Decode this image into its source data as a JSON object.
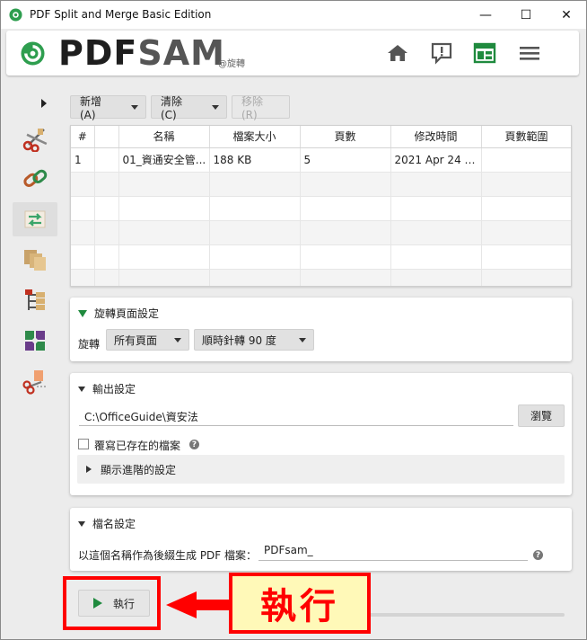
{
  "window": {
    "title": "PDF Split and Merge Basic Edition",
    "minimize": "—",
    "maximize": "☐",
    "close": "✕"
  },
  "header": {
    "logo_pdf": "PDF",
    "logo_sam": "SAM",
    "module_tag": "@旋轉"
  },
  "toolbar": {
    "add_label": "新增 (A)",
    "clear_label": "清除 (C)",
    "remove_label": "移除 (R)"
  },
  "table": {
    "columns": [
      "#",
      "",
      "名稱",
      "檔案大小",
      "頁數",
      "修改時間",
      "頁數範圍"
    ],
    "rows": [
      [
        "1",
        "",
        "01_資通安全管...",
        "188 KB",
        "5",
        "2021 Apr 24 1...",
        ""
      ]
    ]
  },
  "rotate_panel": {
    "title": "旋轉頁面設定",
    "rotate_label": "旋轉",
    "pages_value": "所有頁面",
    "angle_value": "順時針轉 90 度"
  },
  "output_panel": {
    "title": "輸出設定",
    "path_value": "C:\\OfficeGuide\\資安法",
    "browse_label": "瀏覽",
    "overwrite_label": "覆寫已存在的檔案",
    "help": "?",
    "advanced_label": "顯示進階的設定"
  },
  "filename_panel": {
    "title": "檔名設定",
    "prefix_label": "以這個名稱作為後綴生成 PDF 檔案：",
    "prefix_value": "PDFsam_",
    "help": "?"
  },
  "run": {
    "run_label": "執行",
    "callout_label": "執行"
  },
  "colors": {
    "accent_green": "#1f8a3e",
    "highlight_red": "#ff0000",
    "callout_bg": "#fff9b8"
  }
}
